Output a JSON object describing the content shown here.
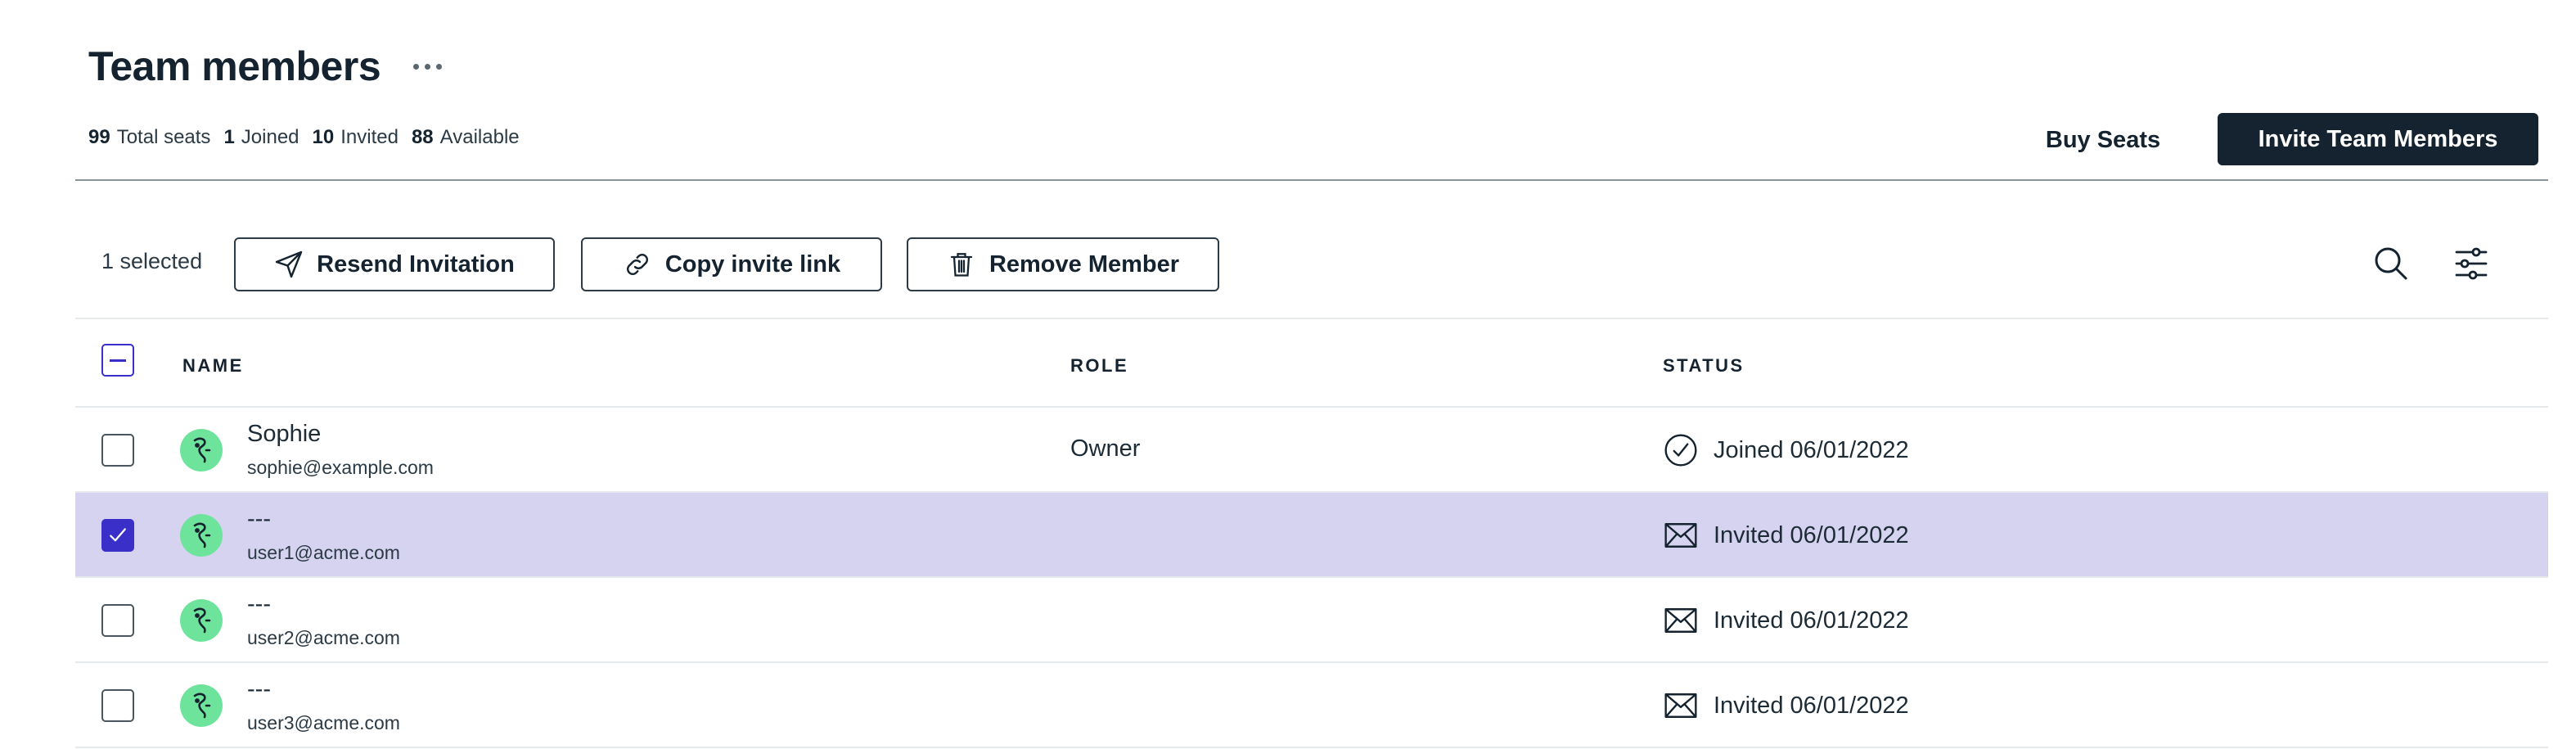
{
  "header": {
    "title": "Team members",
    "more_icon": "more-horizontal-icon",
    "seats": [
      {
        "count": "99",
        "label": "Total seats"
      },
      {
        "count": "1",
        "label": "Joined"
      },
      {
        "count": "10",
        "label": "Invited"
      },
      {
        "count": "88",
        "label": "Available"
      }
    ],
    "buy_seats_label": "Buy Seats",
    "invite_label": "Invite Team Members"
  },
  "toolbar": {
    "selected_text": "1 selected",
    "resend_label": "Resend Invitation",
    "resend_icon": "send-icon",
    "copy_label": "Copy invite link",
    "copy_icon": "link-icon",
    "remove_label": "Remove Member",
    "remove_icon": "trash-icon",
    "search_icon": "search-icon",
    "filter_icon": "filter-sliders-icon"
  },
  "table": {
    "columns": {
      "name": "NAME",
      "role": "ROLE",
      "status": "STATUS"
    },
    "select_all_state": "indeterminate",
    "rows": [
      {
        "name": "Sophie",
        "email": "sophie@example.com",
        "role": "Owner",
        "status": "Joined 06/01/2022",
        "status_icon": "check-circle-icon",
        "selected": false
      },
      {
        "name": "---",
        "email": "user1@acme.com",
        "role": "",
        "status": "Invited 06/01/2022",
        "status_icon": "envelope-icon",
        "selected": true
      },
      {
        "name": "---",
        "email": "user2@acme.com",
        "role": "",
        "status": "Invited 06/01/2022",
        "status_icon": "envelope-icon",
        "selected": false
      },
      {
        "name": "---",
        "email": "user3@acme.com",
        "role": "",
        "status": "Invited 06/01/2022",
        "status_icon": "envelope-icon",
        "selected": false
      }
    ]
  },
  "colors": {
    "primary": "#14232f",
    "accent": "#3b2fc9",
    "selected_row": "#d6d3f1",
    "avatar": "#6ee39b"
  }
}
